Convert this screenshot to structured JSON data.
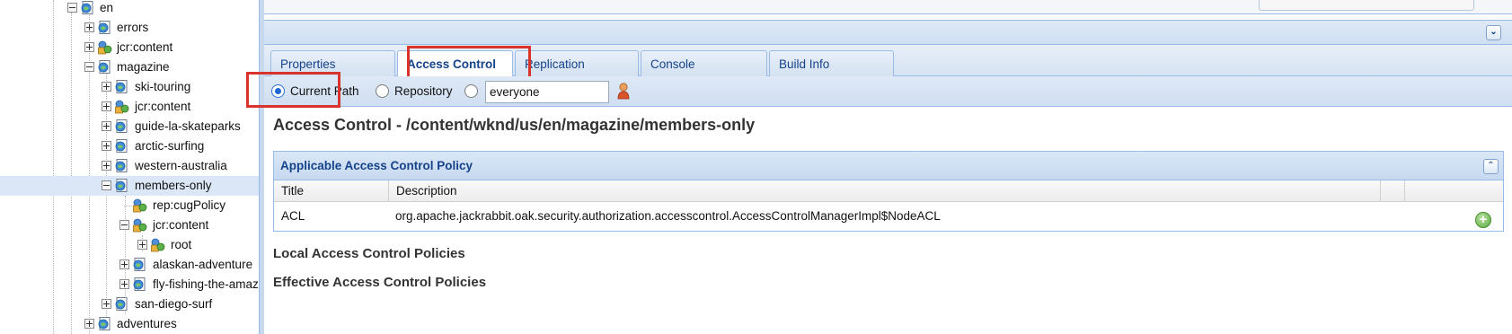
{
  "tree": {
    "nodes": [
      {
        "label": "en",
        "toggle": "minus"
      },
      {
        "label": "errors",
        "toggle": "plus"
      },
      {
        "label": "jcr:content",
        "toggle": "plus"
      },
      {
        "label": "magazine",
        "toggle": "minus"
      },
      {
        "label": "ski-touring",
        "toggle": "plus"
      },
      {
        "label": "jcr:content",
        "toggle": "plus"
      },
      {
        "label": "guide-la-skateparks",
        "toggle": "plus"
      },
      {
        "label": "arctic-surfing",
        "toggle": "plus"
      },
      {
        "label": "western-australia",
        "toggle": "plus"
      },
      {
        "label": "members-only",
        "toggle": "minus",
        "selected": true
      },
      {
        "label": "rep:cugPolicy",
        "toggle": "none"
      },
      {
        "label": "jcr:content",
        "toggle": "minus"
      },
      {
        "label": "root",
        "toggle": "plus"
      },
      {
        "label": "alaskan-adventure",
        "toggle": "plus"
      },
      {
        "label": "fly-fishing-the-amaz",
        "toggle": "plus"
      },
      {
        "label": "san-diego-surf",
        "toggle": "plus"
      },
      {
        "label": "adventures",
        "toggle": "plus"
      }
    ]
  },
  "tabs": [
    {
      "label": "Properties"
    },
    {
      "label": "Access Control",
      "active": true
    },
    {
      "label": "Replication"
    },
    {
      "label": "Console"
    },
    {
      "label": "Build Info"
    }
  ],
  "scope": {
    "current_path": "Current Path",
    "repository": "Repository",
    "principal_value": "everyone",
    "selected": "current_path"
  },
  "heading": "Access Control - /content/wknd/us/en/magazine/members-only",
  "applicable": {
    "title": "Applicable Access Control Policy",
    "columns": [
      "Title",
      "Description"
    ],
    "rows": [
      {
        "title": "ACL",
        "description": "org.apache.jackrabbit.oak.security.authorization.accesscontrol.AccessControlManagerImpl$NodeACL"
      }
    ]
  },
  "local_title": "Local Access Control Policies",
  "effective_title": "Effective Access Control Policies",
  "colors": {
    "accent": "#15428b",
    "highlight_box": "#d9342b",
    "selected_row": "#dbe7f6"
  }
}
